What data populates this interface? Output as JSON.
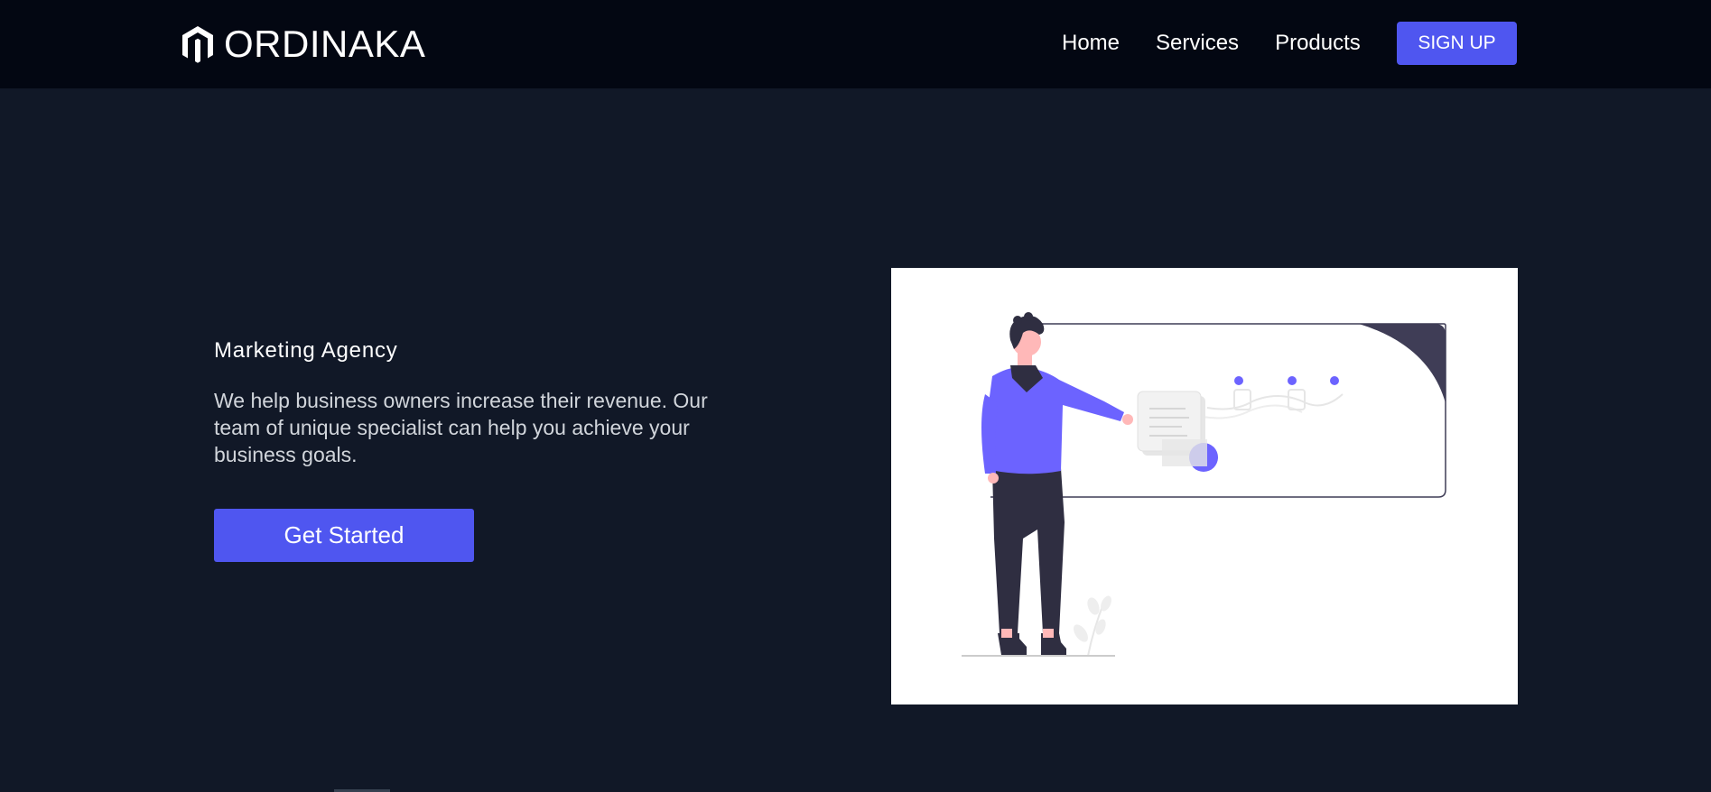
{
  "navbar": {
    "brand": "ORDINAKA",
    "links": [
      "Home",
      "Services",
      "Products"
    ],
    "signup_label": "SIGN UP"
  },
  "hero": {
    "title": "Marketing Agency",
    "description": "We help business owners increase their revenue. Our team of unique specialist can help you achieve your business goals.",
    "cta_label": "Get Started"
  },
  "colors": {
    "background": "#111827",
    "navbar": "#030712",
    "accent": "#4f56f0",
    "illustration_dark": "#3f3d56",
    "illustration_accent": "#6c63ff"
  },
  "icons": {
    "brand_logo": "magento-style-logo-icon"
  }
}
